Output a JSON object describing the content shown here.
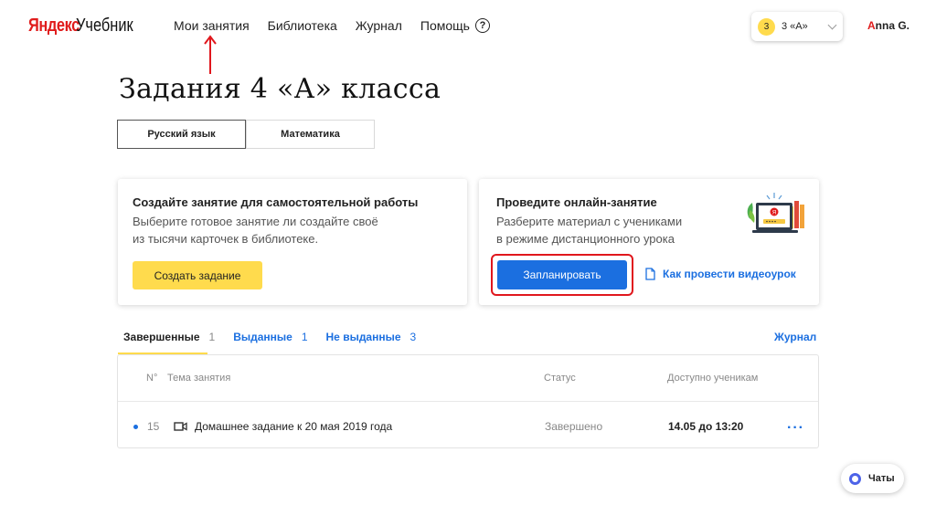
{
  "header": {
    "logo_brand": "Яндекс",
    "logo_product": "Учебник",
    "nav": [
      "Мои занятия",
      "Библиотека",
      "Журнал",
      "Помощь"
    ],
    "help_icon_glyph": "?",
    "class_badge": "3",
    "class_label": "3 «А»",
    "user_first_letter": "A",
    "user_rest": "nna G."
  },
  "page_title": "Задания 4 «А» класса",
  "subject_tabs": [
    "Русский язык",
    "Математика"
  ],
  "card_self_work": {
    "title": "Создайте занятие для самостоятельной работы",
    "text_line1": "Выберите готовое занятие ли создайте своё",
    "text_line2": "из тысячи карточек в библиотеке.",
    "button": "Создать задание"
  },
  "card_online": {
    "title": "Проведите онлайн-занятие",
    "text_line1": "Разберите материал с учениками",
    "text_line2": "в режиме дистанционного урока",
    "button": "Запланировать",
    "link": "Как провести видеоурок"
  },
  "filters": [
    {
      "label": "Завершенные",
      "count": "1"
    },
    {
      "label": "Выданные",
      "count": "1"
    },
    {
      "label": "Не выданные",
      "count": "3"
    }
  ],
  "journal_link": "Журнал",
  "table": {
    "headers": {
      "num": "N°",
      "topic": "Тема занятия",
      "status": "Статус",
      "available": "Доступно ученикам"
    },
    "rows": [
      {
        "num": "15",
        "topic": "Домашнее задание к 20 мая 2019 года",
        "status": "Завершено",
        "available": "14.05 до 13:20",
        "more": "···"
      }
    ]
  },
  "chats_label": "Чаты",
  "colors": {
    "accent_yellow": "#ffdb4d",
    "link_blue": "#1b6fe0",
    "brand_red": "#e01c1c",
    "annotation_red": "#e0171d"
  }
}
